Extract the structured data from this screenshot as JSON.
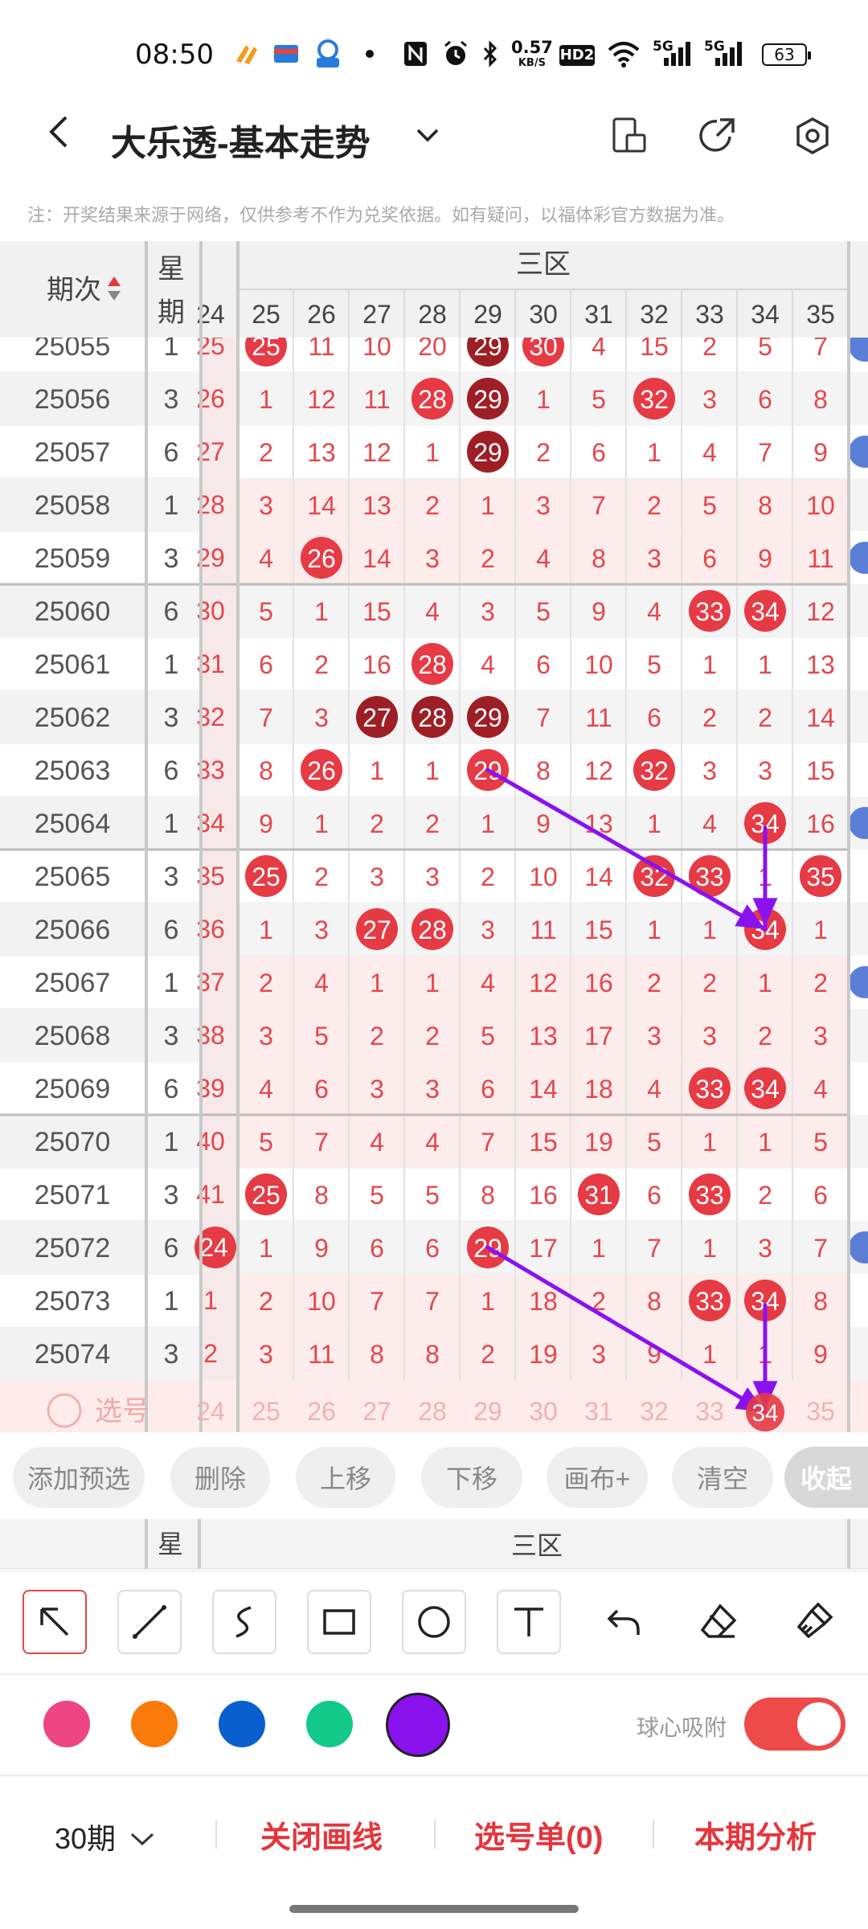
{
  "status_bar": {
    "time": "08:50",
    "net_speed_value": "0.57",
    "net_speed_unit": "KB/S",
    "hd": "HD2",
    "signal1": "5G",
    "signal2": "5G",
    "battery": "63"
  },
  "header": {
    "title": "大乐透-基本走势"
  },
  "notice": "注：开奖结果来源于网络，仅供参考不作为兑奖依据。如有疑问，以福体彩官方数据为准。",
  "table": {
    "col_issue": "期次",
    "col_week": "星期",
    "zone_label": "三区",
    "columns": [
      "25",
      "26",
      "27",
      "28",
      "29",
      "30",
      "31",
      "32",
      "33",
      "34",
      "35"
    ],
    "partial_col": "24",
    "rows": [
      {
        "issue": "25055",
        "week": "1",
        "partial": "25",
        "cells": [
          "25",
          "11",
          "10",
          "20",
          "29",
          "30",
          "4",
          "15",
          "2",
          "5",
          "7"
        ]
      },
      {
        "issue": "25056",
        "week": "3",
        "partial": "26",
        "cells": [
          "1",
          "12",
          "11",
          "28",
          "29",
          "1",
          "5",
          "32",
          "3",
          "6",
          "8"
        ]
      },
      {
        "issue": "25057",
        "week": "6",
        "partial": "27",
        "cells": [
          "2",
          "13",
          "12",
          "1",
          "29",
          "2",
          "6",
          "1",
          "4",
          "7",
          "9"
        ]
      },
      {
        "issue": "25058",
        "week": "1",
        "partial": "28",
        "cells": [
          "3",
          "14",
          "13",
          "2",
          "1",
          "3",
          "7",
          "2",
          "5",
          "8",
          "10"
        ]
      },
      {
        "issue": "25059",
        "week": "3",
        "partial": "29",
        "cells": [
          "4",
          "26",
          "14",
          "3",
          "2",
          "4",
          "8",
          "3",
          "6",
          "9",
          "11"
        ]
      },
      {
        "issue": "25060",
        "week": "6",
        "partial": "30",
        "cells": [
          "5",
          "1",
          "15",
          "4",
          "3",
          "5",
          "9",
          "4",
          "33",
          "34",
          "12"
        ]
      },
      {
        "issue": "25061",
        "week": "1",
        "partial": "31",
        "cells": [
          "6",
          "2",
          "16",
          "28",
          "4",
          "6",
          "10",
          "5",
          "1",
          "1",
          "13"
        ]
      },
      {
        "issue": "25062",
        "week": "3",
        "partial": "32",
        "cells": [
          "7",
          "3",
          "27",
          "28",
          "29",
          "7",
          "11",
          "6",
          "2",
          "2",
          "14"
        ]
      },
      {
        "issue": "25063",
        "week": "6",
        "partial": "33",
        "cells": [
          "8",
          "26",
          "1",
          "1",
          "29",
          "8",
          "12",
          "32",
          "3",
          "3",
          "15"
        ]
      },
      {
        "issue": "25064",
        "week": "1",
        "partial": "34",
        "cells": [
          "9",
          "1",
          "2",
          "2",
          "1",
          "9",
          "13",
          "1",
          "4",
          "34",
          "16"
        ]
      },
      {
        "issue": "25065",
        "week": "3",
        "partial": "35",
        "cells": [
          "25",
          "2",
          "3",
          "3",
          "2",
          "10",
          "14",
          "32",
          "33",
          "1",
          "35"
        ]
      },
      {
        "issue": "25066",
        "week": "6",
        "partial": "36",
        "cells": [
          "1",
          "3",
          "27",
          "28",
          "3",
          "11",
          "15",
          "1",
          "1",
          "34",
          "1"
        ]
      },
      {
        "issue": "25067",
        "week": "1",
        "partial": "37",
        "cells": [
          "2",
          "4",
          "1",
          "1",
          "4",
          "12",
          "16",
          "2",
          "2",
          "1",
          "2"
        ]
      },
      {
        "issue": "25068",
        "week": "3",
        "partial": "38",
        "cells": [
          "3",
          "5",
          "2",
          "2",
          "5",
          "13",
          "17",
          "3",
          "3",
          "2",
          "3"
        ]
      },
      {
        "issue": "25069",
        "week": "6",
        "partial": "39",
        "cells": [
          "4",
          "6",
          "3",
          "3",
          "6",
          "14",
          "18",
          "4",
          "33",
          "34",
          "4"
        ]
      },
      {
        "issue": "25070",
        "week": "1",
        "partial": "40",
        "cells": [
          "5",
          "7",
          "4",
          "4",
          "7",
          "15",
          "19",
          "5",
          "1",
          "1",
          "5"
        ]
      },
      {
        "issue": "25071",
        "week": "3",
        "partial": "41",
        "cells": [
          "25",
          "8",
          "5",
          "5",
          "8",
          "16",
          "31",
          "6",
          "33",
          "2",
          "6"
        ]
      },
      {
        "issue": "25072",
        "week": "6",
        "partial": "24",
        "cells": [
          "1",
          "9",
          "6",
          "6",
          "29",
          "17",
          "1",
          "7",
          "1",
          "3",
          "7"
        ]
      },
      {
        "issue": "25073",
        "week": "1",
        "partial": "1",
        "cells": [
          "2",
          "10",
          "7",
          "7",
          "1",
          "18",
          "2",
          "8",
          "33",
          "34",
          "8"
        ]
      },
      {
        "issue": "25074",
        "week": "3",
        "partial": "2",
        "cells": [
          "3",
          "11",
          "8",
          "8",
          "2",
          "19",
          "3",
          "9",
          "1",
          "1",
          "9"
        ]
      }
    ],
    "pick_label": "选号",
    "pick_numbers": [
      "24",
      "25",
      "26",
      "27",
      "28",
      "29",
      "30",
      "31",
      "32",
      "33",
      "34",
      "35"
    ]
  },
  "actions": [
    "添加预选",
    "删除",
    "上移",
    "下移",
    "画布+",
    "清空"
  ],
  "collapse_label": "收起",
  "mini_header": {
    "col_week": "星",
    "zone_label": "三区"
  },
  "draw_tools": [
    "select",
    "line",
    "curve",
    "rectangle",
    "circle",
    "text",
    "undo",
    "eraser",
    "clear"
  ],
  "colors": [
    "#ee4583",
    "#fa7a0a",
    "#0a5fcf",
    "#12c98a",
    "#8a12ef"
  ],
  "snap_label": "球心吸附",
  "bottom": {
    "periods": "30期",
    "close_lines": "关闭画线",
    "pick_list": "选号单(0)",
    "analysis": "本期分析"
  }
}
